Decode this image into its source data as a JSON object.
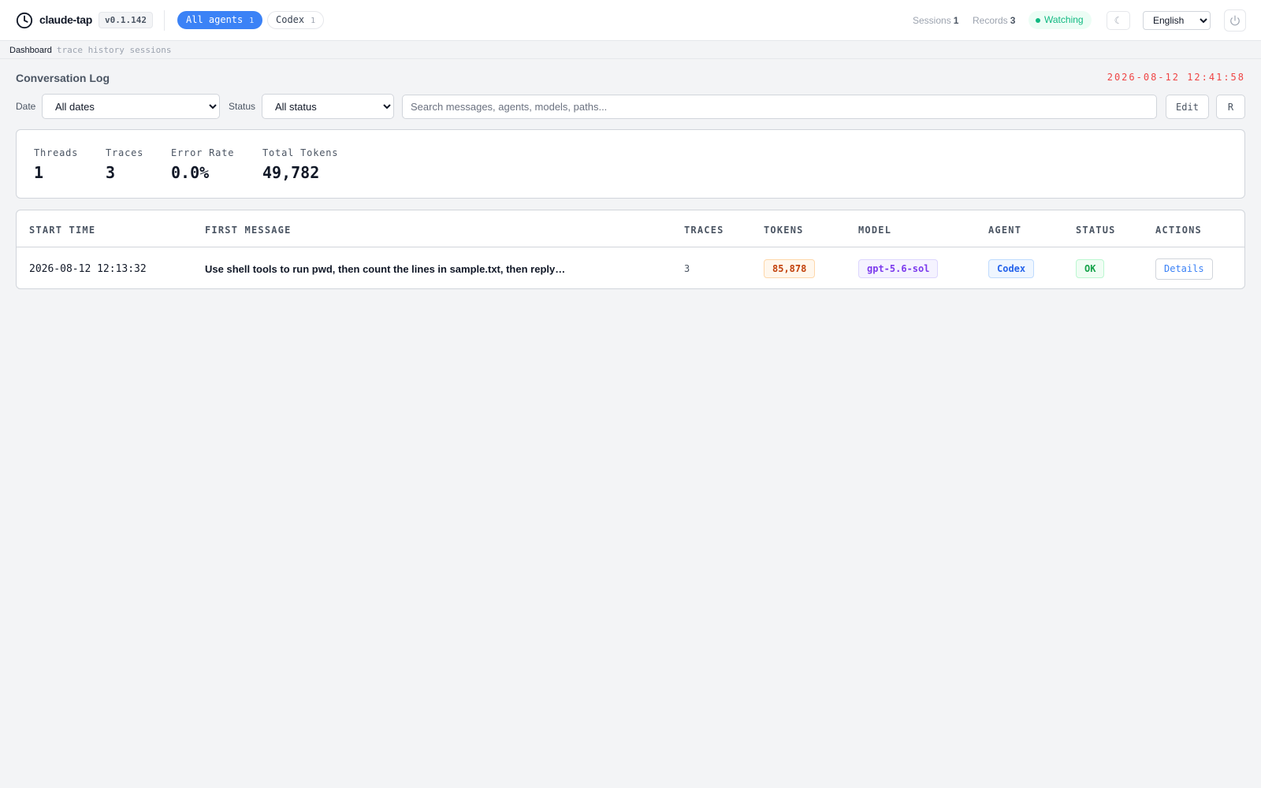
{
  "header": {
    "app_name": "claude-tap",
    "version": "v0.1.142",
    "agent_filters": [
      {
        "label": "All agents",
        "count": "1",
        "active": true
      },
      {
        "label": "Codex",
        "count": "1",
        "active": false
      }
    ],
    "sessions_label": "Sessions",
    "sessions_count": "1",
    "records_label": "Records",
    "records_count": "3",
    "watching_label": "Watching",
    "theme_icon": "moon-icon",
    "theme_glyph": "☾",
    "language": "English",
    "power_icon": "power-icon",
    "accent_color": "#3b82f6",
    "watching_color": "#10b981"
  },
  "breadcrumb": {
    "current": "Dashboard",
    "sub": "trace history sessions"
  },
  "log": {
    "title": "Conversation Log",
    "timestamp": "2026-08-12 12:41:58",
    "timestamp_color": "#ef4444"
  },
  "filters": {
    "date_label": "Date",
    "date_value": "All dates",
    "status_label": "Status",
    "status_value": "All status",
    "search_placeholder": "Search messages, agents, models, paths...",
    "search_value": "",
    "edit_label": "Edit",
    "r_label": "R"
  },
  "stats": {
    "threads_label": "Threads",
    "threads_value": "1",
    "traces_label": "Traces",
    "traces_value": "3",
    "error_rate_label": "Error Rate",
    "error_rate_value": "0.0%",
    "total_tokens_label": "Total Tokens",
    "total_tokens_value": "49,782"
  },
  "table": {
    "columns": [
      "START TIME",
      "FIRST MESSAGE",
      "TRACES",
      "TOKENS",
      "MODEL",
      "AGENT",
      "STATUS",
      "ACTIONS"
    ],
    "rows": [
      {
        "start_time": "2026-08-12 12:13:32",
        "first_message": "Use shell tools to run pwd, then count the lines in sample.txt, then reply…",
        "traces": "3",
        "tokens": "85,878",
        "model": "gpt-5.6-sol",
        "agent": "Codex",
        "status": "OK",
        "action": "Details"
      }
    ]
  }
}
